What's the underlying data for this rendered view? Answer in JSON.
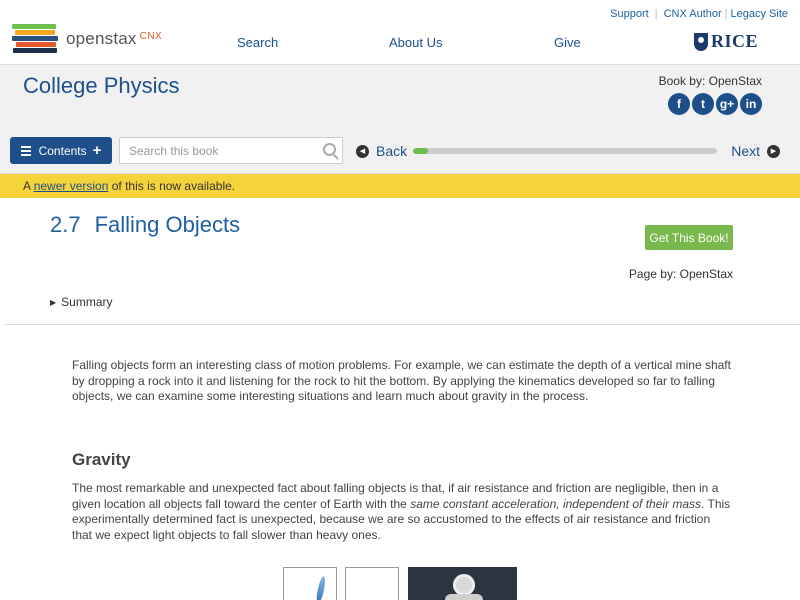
{
  "header": {
    "logo": {
      "brand": "openstax",
      "suffix": "CNX"
    },
    "util_links": [
      "Support",
      "CNX Author",
      "Legacy Site"
    ],
    "nav": [
      "Search",
      "About Us",
      "Give"
    ],
    "partner_logo": "RICE",
    "logo_bar_colors": [
      "#6fbf4f",
      "#f5a623",
      "#2b4f81",
      "#e05a2b",
      "#1e2f4a"
    ]
  },
  "book": {
    "title": "College Physics",
    "by_label": "Book by: OpenStax",
    "socials": [
      {
        "name": "facebook",
        "glyph": "f"
      },
      {
        "name": "twitter",
        "glyph": "t"
      },
      {
        "name": "google-plus",
        "glyph": "g+"
      },
      {
        "name": "linkedin",
        "glyph": "in"
      }
    ]
  },
  "toolbar": {
    "contents_label": "Contents",
    "search_placeholder": "Search this book",
    "back_label": "Back",
    "next_label": "Next",
    "progress_fraction": 0.05
  },
  "notice": {
    "prefix": "A ",
    "link": "newer version",
    "suffix": " of this is now available."
  },
  "page": {
    "chapter_number": "2.7",
    "chapter_title": "Falling Objects",
    "get_book_label": "Get This Book!",
    "page_by_label": "Page by: OpenStax",
    "summary_label": "Summary",
    "intro": "Falling objects form an interesting class of motion problems. For example, we can estimate the depth of a vertical mine shaft by dropping a rock into it and listening for the rock to hit the bottom. By applying the kinematics developed so far to falling objects, we can examine some interesting situations and learn much about gravity in the process.",
    "gravity_heading": "Gravity",
    "gravity_before": "The most remarkable and unexpected fact about falling objects is that, if air resistance and friction are negligible, then in a given location all objects fall toward the center of Earth with the ",
    "gravity_em1": "same constant acceleration",
    "gravity_comma": ", ",
    "gravity_em2": "independent of their mass",
    "gravity_after": ". This experimentally determined fact is unexpected, because we are so accustomed to the effects of air resistance and friction that we expect light objects to fall slower than heavy ones."
  }
}
